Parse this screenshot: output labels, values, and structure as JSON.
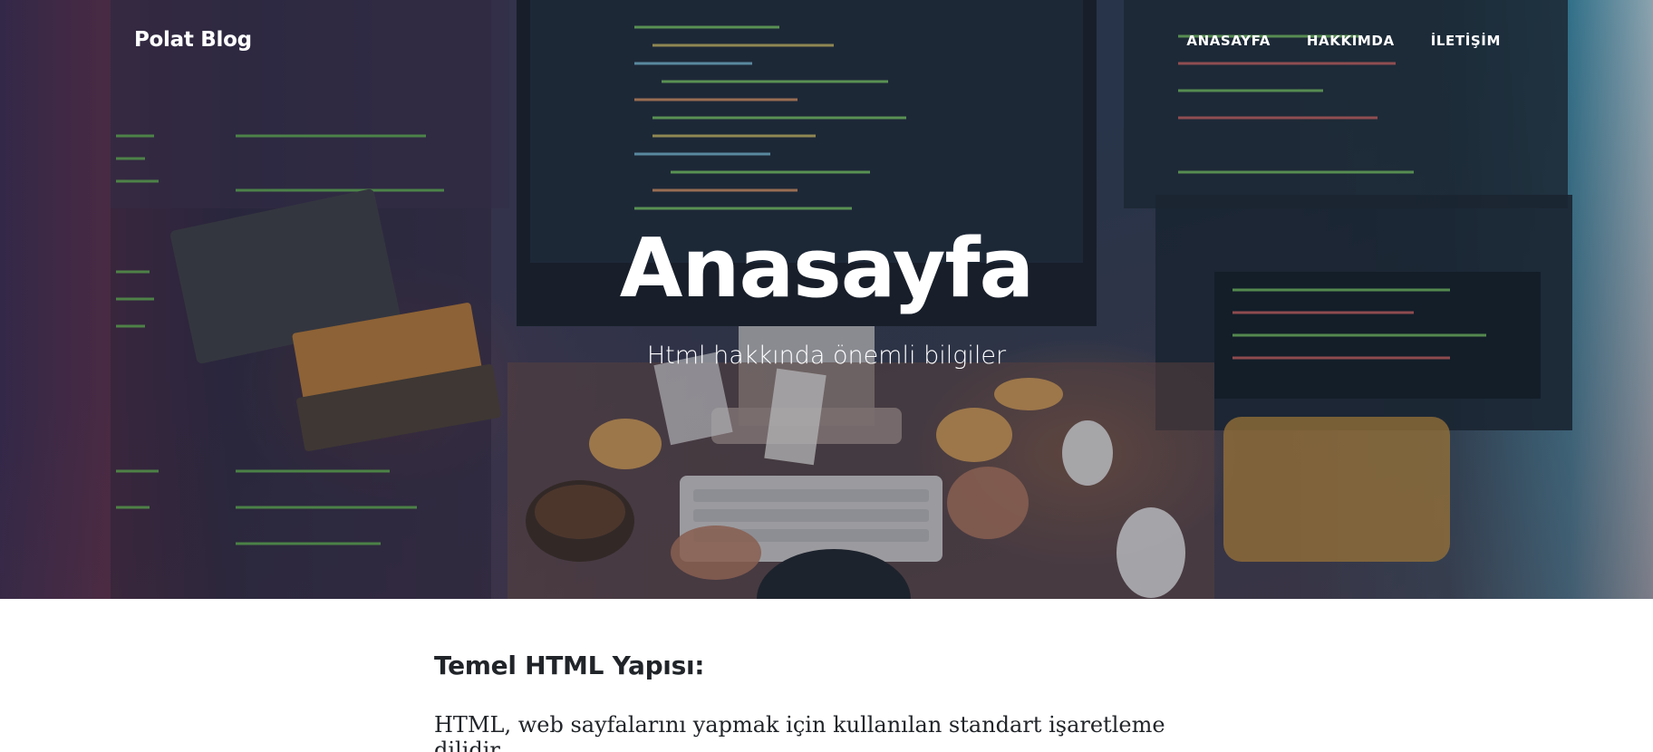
{
  "navbar": {
    "brand": "Polat Blog",
    "links": [
      {
        "label": "ANASAYFA"
      },
      {
        "label": "HAKKIMDA"
      },
      {
        "label": "İLETİŞİM"
      }
    ]
  },
  "hero": {
    "title": "Anasayfa",
    "subtitle": "Html hakkında önemli bilgiler"
  },
  "content": {
    "heading": "Temel HTML Yapısı:",
    "paragraph": "HTML, web sayfalarını yapmak için kullanılan standart işaretleme dilidir."
  },
  "colors": {
    "text_dark": "#212529",
    "text_light": "#ffffff"
  }
}
